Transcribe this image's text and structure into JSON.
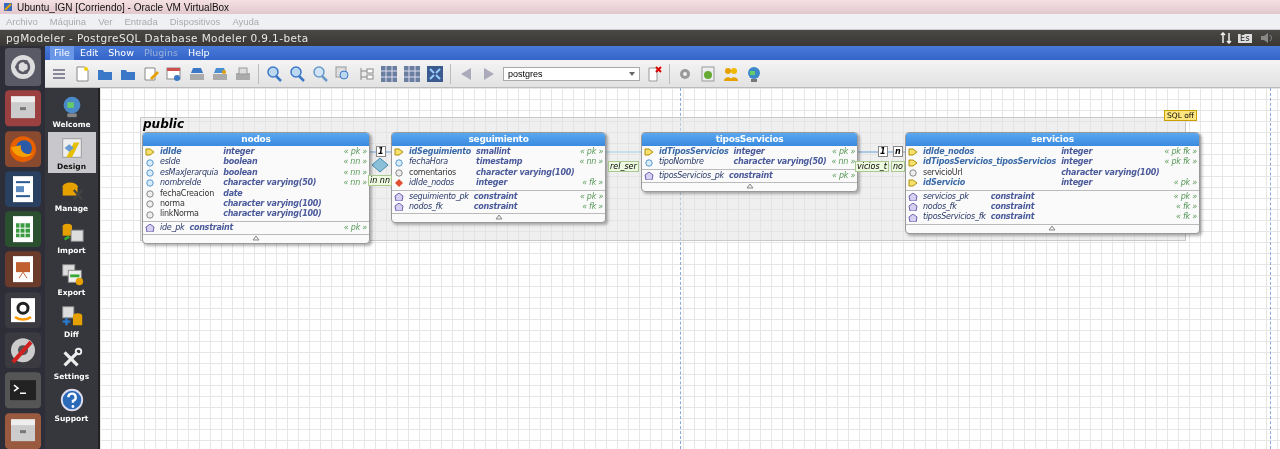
{
  "vbox_window": {
    "title": "Ubuntu_IGN [Corriendo] - Oracle VM VirtualBox",
    "menu": [
      {
        "label": "Archivo",
        "disabled": true
      },
      {
        "label": "Máquina",
        "disabled": true
      },
      {
        "label": "Ver",
        "disabled": true
      },
      {
        "label": "Entrada",
        "disabled": true
      },
      {
        "label": "Dispositivos",
        "disabled": true
      },
      {
        "label": "Ayuda",
        "disabled": true
      }
    ]
  },
  "top_panel": {
    "title": "pgModeler - PostgreSQL Database Modeler 0.9.1-beta",
    "keyboard_layout": "Es"
  },
  "menu": [
    {
      "label": "File",
      "selected": true,
      "disabled": false
    },
    {
      "label": "Edit",
      "selected": false,
      "disabled": false
    },
    {
      "label": "Show",
      "selected": false,
      "disabled": false
    },
    {
      "label": "Plugins",
      "selected": false,
      "disabled": true
    },
    {
      "label": "Help",
      "selected": false,
      "disabled": false
    }
  ],
  "toolbar": {
    "connection": "postgres"
  },
  "sidebar": {
    "items": [
      {
        "label": "Welcome",
        "selected": false
      },
      {
        "label": "Design",
        "selected": true
      },
      {
        "label": "Manage",
        "selected": false
      },
      {
        "label": "Import",
        "selected": false
      },
      {
        "label": "Export",
        "selected": false
      },
      {
        "label": "Diff",
        "selected": false
      },
      {
        "label": "Settings",
        "selected": false
      },
      {
        "label": "Support",
        "selected": false
      }
    ]
  },
  "canvas": {
    "sql_badge": "SQL off",
    "schema": {
      "name": "public",
      "tables": [
        {
          "name": "nodos",
          "columns": [
            {
              "name": "idIde",
              "type": "integer",
              "constraint": "« pk »",
              "kind": "pk"
            },
            {
              "name": "esIde",
              "type": "boolean",
              "constraint": "« nn »",
              "kind": "nn"
            },
            {
              "name": "esMaxJerarquia",
              "type": "boolean",
              "constraint": "« nn »",
              "kind": "nn"
            },
            {
              "name": "nombreIde",
              "type": "character varying(50)",
              "constraint": "« nn »",
              "kind": "nn"
            },
            {
              "name": "fechaCreacion",
              "type": "date",
              "kind": "plain"
            },
            {
              "name": "norma",
              "type": "character varying(100)",
              "kind": "plain"
            },
            {
              "name": "linkNorma",
              "type": "character varying(100)",
              "kind": "plain"
            }
          ],
          "constraints": [
            {
              "name": "ide_pk",
              "type": "constraint",
              "constraint": "« pk »"
            }
          ]
        },
        {
          "name": "seguimiento",
          "columns": [
            {
              "name": "idSeguimiento",
              "type": "smallint",
              "constraint": "« pk »",
              "kind": "pk"
            },
            {
              "name": "fechaHora",
              "type": "timestamp",
              "constraint": "« nn »",
              "kind": "nn"
            },
            {
              "name": "comentarios",
              "type": "character varying(100)",
              "kind": "plain"
            },
            {
              "name": "idIde_nodos",
              "type": "integer",
              "constraint": "« fk »",
              "kind": "fk"
            }
          ],
          "constraints": [
            {
              "name": "seguimiento_pk",
              "type": "constraint",
              "constraint": "« pk »"
            },
            {
              "name": "nodos_fk",
              "type": "constraint",
              "constraint": "« fk »"
            }
          ]
        },
        {
          "name": "tiposServicios",
          "columns": [
            {
              "name": "idTiposServicios",
              "type": "integer",
              "constraint": "« pk »",
              "kind": "pk"
            },
            {
              "name": "tipoNombre",
              "type": "character varying(50)",
              "constraint": "« nn »",
              "kind": "nn"
            }
          ],
          "constraints": [
            {
              "name": "tiposServicios_pk",
              "type": "constraint",
              "constraint": "« pk »"
            }
          ]
        },
        {
          "name": "servicios",
          "columns": [
            {
              "name": "idIde_nodos",
              "type": "integer",
              "constraint": "« pk fk »",
              "kind": "pk"
            },
            {
              "name": "idTiposServicios_tiposServicios",
              "type": "integer",
              "constraint": "« pk fk »",
              "kind": "pk"
            },
            {
              "name": "servicioUrl",
              "type": "character varying(100)",
              "kind": "plain"
            },
            {
              "name": "idServicio",
              "type": "integer",
              "constraint": "« pk »",
              "kind": "pk"
            }
          ],
          "constraints": [
            {
              "name": "servicios_pk",
              "type": "constraint",
              "constraint": "« pk »"
            },
            {
              "name": "nodos_fk",
              "type": "constraint",
              "constraint": "« fk »"
            },
            {
              "name": "tiposServicios_fk",
              "type": "constraint",
              "constraint": "« fk »"
            }
          ]
        }
      ]
    },
    "relationship_labels": [
      {
        "text": "1",
        "kind": "cardinality"
      },
      {
        "text": "in nn",
        "kind": "name"
      },
      {
        "text": "rel_ser",
        "kind": "name"
      },
      {
        "text": "1",
        "kind": "cardinality"
      },
      {
        "text": "n",
        "kind": "cardinality"
      },
      {
        "text": "vicios_t",
        "kind": "name"
      },
      {
        "text": "no",
        "kind": "name"
      }
    ]
  }
}
